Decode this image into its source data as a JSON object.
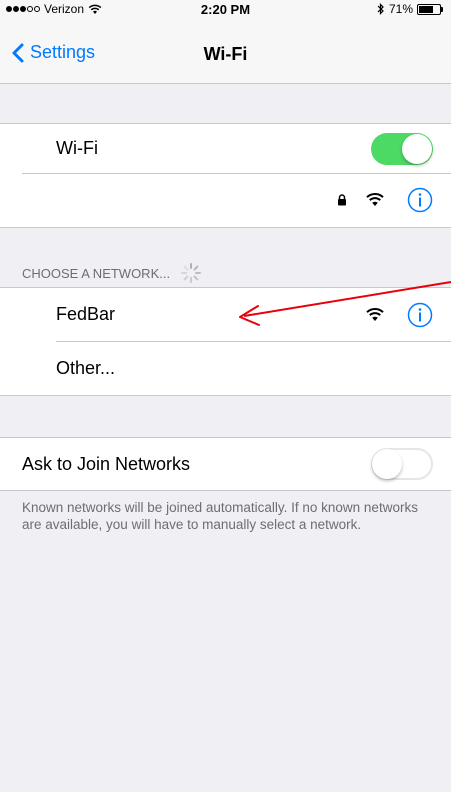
{
  "status_bar": {
    "carrier": "Verizon",
    "time": "2:20 PM",
    "battery_percent": "71%",
    "battery_level": 0.71,
    "signal_filled": 3,
    "signal_total": 5
  },
  "nav": {
    "back_label": "Settings",
    "title": "Wi-Fi"
  },
  "wifi_row": {
    "label": "Wi-Fi",
    "enabled": true
  },
  "section_header": "CHOOSE A NETWORK...",
  "networks": [
    {
      "name": "FedBar"
    },
    {
      "name": "Other..."
    }
  ],
  "ask_to_join": {
    "label": "Ask to Join Networks",
    "enabled": false
  },
  "footer": "Known networks will be joined automatically. If no known networks are available, you will have to manually select a network.",
  "colors": {
    "accent": "#007aff",
    "toggle_on": "#4cd964",
    "annotation": "#e8000b"
  }
}
